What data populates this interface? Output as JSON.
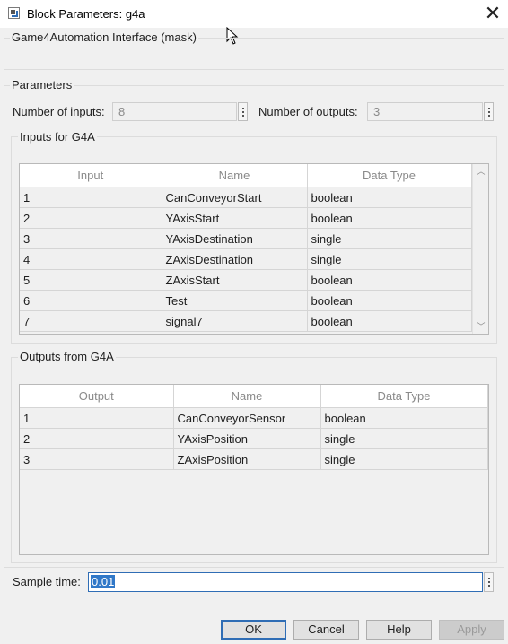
{
  "window": {
    "title": "Block Parameters: g4a",
    "close_glyph": "✕"
  },
  "mask": {
    "description": "Game4Automation Interface (mask)"
  },
  "parameters": {
    "group_label": "Parameters",
    "num_inputs_label": "Number of inputs:",
    "num_inputs_value": "8",
    "num_outputs_label": "Number of outputs:",
    "num_outputs_value": "3"
  },
  "inputs": {
    "group_label": "Inputs for G4A",
    "columns": [
      "Input",
      "Name",
      "Data Type"
    ],
    "rows": [
      [
        "1",
        "CanConveyorStart",
        "boolean"
      ],
      [
        "2",
        "YAxisStart",
        "boolean"
      ],
      [
        "3",
        "YAxisDestination",
        "single"
      ],
      [
        "4",
        "ZAxisDestination",
        "single"
      ],
      [
        "5",
        "ZAxisStart",
        "boolean"
      ],
      [
        "6",
        "Test",
        "boolean"
      ],
      [
        "7",
        "signal7",
        "boolean"
      ]
    ]
  },
  "outputs": {
    "group_label": "Outputs from G4A",
    "columns": [
      "Output",
      "Name",
      "Data Type"
    ],
    "rows": [
      [
        "1",
        "CanConveyorSensor",
        "boolean"
      ],
      [
        "2",
        "YAxisPosition",
        "single"
      ],
      [
        "3",
        "ZAxisPosition",
        "single"
      ]
    ]
  },
  "sample_time": {
    "label": "Sample time:",
    "value": "0.01"
  },
  "buttons": {
    "ok": "OK",
    "cancel": "Cancel",
    "help": "Help",
    "apply": "Apply"
  },
  "icons": {
    "window": "block-parameters-icon",
    "close": "close-icon",
    "scroll_up": "chevron-up-icon",
    "scroll_down": "chevron-down-icon"
  }
}
